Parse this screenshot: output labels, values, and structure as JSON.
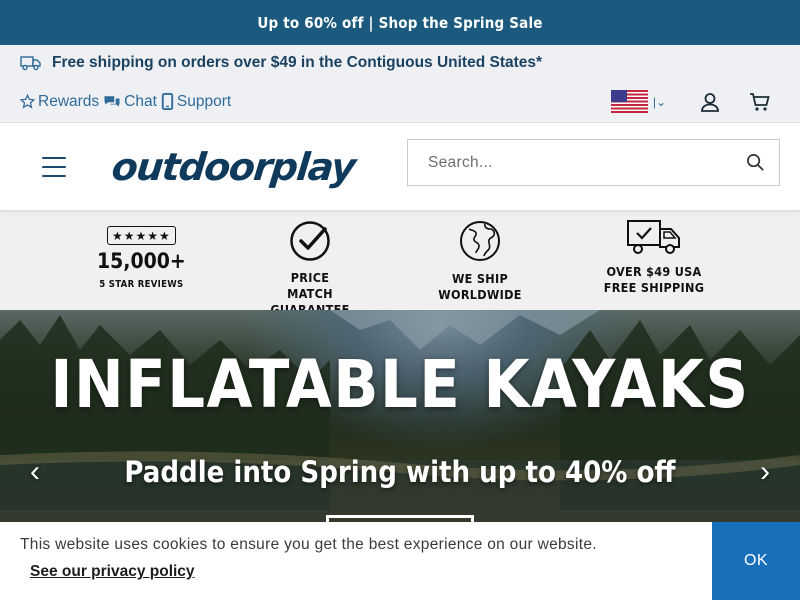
{
  "promo": {
    "text": "Up to 60% off | Shop the Spring Sale"
  },
  "shipping": {
    "text": "Free shipping on orders over $49 in the Contiguous United States*",
    "icon": "truck-icon"
  },
  "util": {
    "rewards_label": "Rewards",
    "chat_label": "Chat",
    "support_label": "Support"
  },
  "header": {
    "logo_text": "outdoorplay",
    "search_placeholder": "Search..."
  },
  "trust": {
    "reviews": {
      "stars": "★★★★★",
      "count": "15,000+",
      "sub": "5 STAR REVIEWS"
    },
    "price_match": {
      "line1": "PRICE MATCH",
      "line2": "GUARANTEE"
    },
    "ship_world": {
      "line1": "WE SHIP",
      "line2": "WORLDWIDE"
    },
    "free_ship": {
      "line1": "OVER $49 USA",
      "line2": "FREE SHIPPING"
    }
  },
  "hero": {
    "title": "INFLATABLE KAYAKS",
    "subtitle": "Paddle into Spring with up to 40% off",
    "prev": "‹",
    "next": "›"
  },
  "cookie": {
    "message": "This website uses cookies to ensure you get the best experience on our website.",
    "link": "See our privacy policy",
    "ok": "OK"
  },
  "colors": {
    "promo_bg": "#1b5a7e",
    "brand_navy": "#103a5c",
    "link_blue": "#2f6b9a",
    "ok_button": "#1a6fba"
  }
}
